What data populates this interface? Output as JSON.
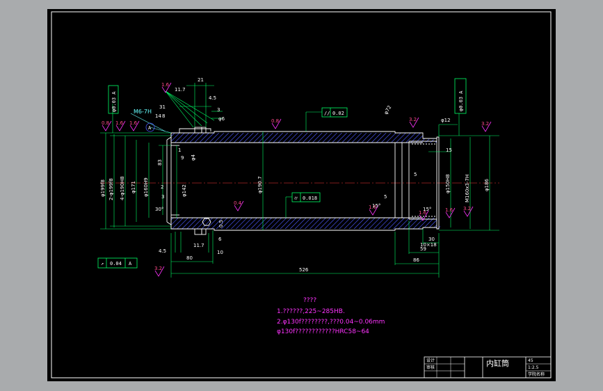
{
  "drawing": {
    "title_block": {
      "part_name": "内缸筒",
      "cell_top_left": "设计",
      "cell_bottom_left": "审核",
      "cell_material": "45",
      "cell_scale": "1:2.5",
      "cell_code": "学院名称"
    },
    "notes": {
      "heading": "????",
      "line1": "1.??????,225~285HB.",
      "line2": "2.φ130f????????,???0.04~0.06mm",
      "line3": "φ130f????????????HRC58~64"
    },
    "tolerance_frames": {
      "top_left_concentricity": "φ0.03 A",
      "top_right_concentricity": "φ0.03 A",
      "parallelism": "0.02",
      "cylindricity": "0.018",
      "bottom_left_runout": "0.04",
      "bottom_left_datum": "A",
      "datum_bubble": "A"
    },
    "thread_callout": "M6-7H",
    "thread_depth": "14",
    "thread_depth_sub": "8",
    "roughness_labels": [
      "1.6",
      "0.8",
      "1.6",
      "1.6",
      "0.8",
      "0.4",
      "3.2",
      "3.2",
      "3.2",
      "1.6",
      "1.6",
      "1.6",
      "3.2"
    ],
    "diameter_labels": {
      "d1": "φ199f8",
      "d2": "2-φ199f8",
      "d3": "4-φ190H8",
      "d4": "φ171",
      "d5": "φ160H9",
      "d6": "φ142",
      "d7": "φ4",
      "d8": "φ190.7",
      "d9": "φ150H8",
      "d10": "M160x3-7H",
      "d11": "φ186",
      "d12": "φ12",
      "d13": "φ6",
      "d14": "φ72"
    },
    "linear_dims": {
      "overall": "526",
      "left_80": "80",
      "right_86": "86",
      "right_59": "59",
      "right_30": "30",
      "right_10x18": "10×18",
      "right_15": "15",
      "right_5a": "5",
      "right_5b": "5",
      "top_21": "21",
      "top_31": "31",
      "top_3": "3",
      "top_4_5": "4.5",
      "top_11_7": "11.7",
      "left_83": "83",
      "left_1": "1",
      "left_9": "9",
      "left_2": "2",
      "left_3": "3",
      "left_6": "6",
      "left_10": "10",
      "left_0_5": "0.5",
      "bottom_4_5": "4.5",
      "bottom_11_7": "11.7",
      "angle_30": "30°",
      "angle_15a": "15°",
      "angle_15b": "15°"
    }
  }
}
